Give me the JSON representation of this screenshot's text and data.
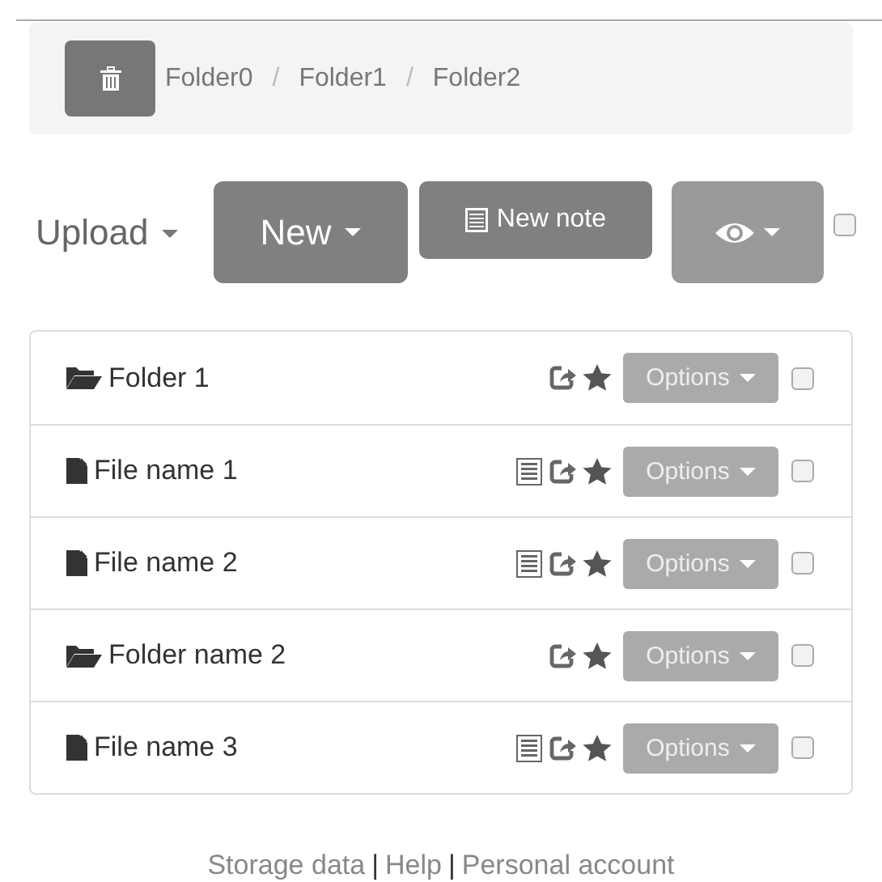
{
  "breadcrumb": {
    "items": [
      "Folder0",
      "Folder1",
      "Folder2"
    ],
    "separator": "/"
  },
  "toolbar": {
    "upload": "Upload",
    "new": "New",
    "new_note": "New note",
    "select_all": {
      "checked": false
    }
  },
  "files": [
    {
      "kind": "folder",
      "name": "Folder 1",
      "note": false,
      "checked": false,
      "options": "Options"
    },
    {
      "kind": "file",
      "name": "File name 1",
      "note": true,
      "checked": false,
      "options": "Options"
    },
    {
      "kind": "file",
      "name": "File name 2",
      "note": true,
      "checked": false,
      "options": "Options"
    },
    {
      "kind": "folder",
      "name": "Folder name 2",
      "note": false,
      "checked": false,
      "options": "Options"
    },
    {
      "kind": "file",
      "name": "File name 3",
      "note": true,
      "checked": false,
      "options": "Options"
    }
  ],
  "footer": {
    "links": [
      "Storage data",
      "Help",
      "Personal account"
    ],
    "separator": "|"
  }
}
